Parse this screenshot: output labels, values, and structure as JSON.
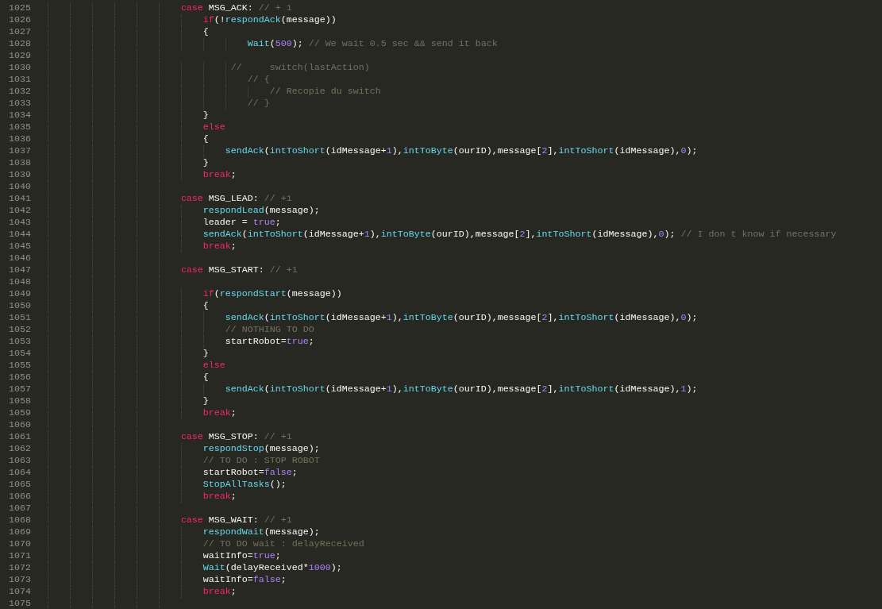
{
  "editor": {
    "lines": [
      {
        "number": "1025",
        "tokens": [
          {
            "kind": "keyword",
            "text": "\t\t\t\t\t\tcase"
          },
          {
            "kind": "plain",
            "text": " MSG_ACK: "
          },
          {
            "kind": "comment",
            "text": "// + 1"
          }
        ]
      },
      {
        "number": "1026",
        "tokens": [
          {
            "kind": "keyword",
            "text": "\t\t\t\t\t\t\tif"
          },
          {
            "kind": "plain",
            "text": "(!"
          },
          {
            "kind": "function",
            "text": "respondAck"
          },
          {
            "kind": "plain",
            "text": "(message))"
          }
        ]
      },
      {
        "number": "1027",
        "tokens": [
          {
            "kind": "plain",
            "text": "\t\t\t\t\t\t\t{"
          }
        ]
      },
      {
        "number": "1028",
        "tokens": [
          {
            "kind": "function",
            "text": "\t\t\t\t\t\t\t\t\tWait"
          },
          {
            "kind": "plain",
            "text": "("
          },
          {
            "kind": "number",
            "text": "500"
          },
          {
            "kind": "plain",
            "text": "); "
          },
          {
            "kind": "comment",
            "text": "// We wait 0.5 sec && send it back"
          }
        ]
      },
      {
        "number": "1029"
      },
      {
        "number": "1030",
        "tokens": [
          {
            "kind": "comment",
            "text": "\t\t\t\t\t\t\t\t //     switch(lastAction)"
          }
        ]
      },
      {
        "number": "1031",
        "tokens": [
          {
            "kind": "comment",
            "text": "\t\t\t\t\t\t\t\t\t// {"
          }
        ]
      },
      {
        "number": "1032",
        "tokens": [
          {
            "kind": "comment",
            "text": "\t\t\t\t\t\t\t\t\t\t// Recopie du switch"
          }
        ]
      },
      {
        "number": "1033",
        "tokens": [
          {
            "kind": "comment",
            "text": "\t\t\t\t\t\t\t\t\t// }"
          }
        ]
      },
      {
        "number": "1034",
        "tokens": [
          {
            "kind": "plain",
            "text": "\t\t\t\t\t\t\t}"
          }
        ]
      },
      {
        "number": "1035",
        "tokens": [
          {
            "kind": "keyword",
            "text": "\t\t\t\t\t\t\telse"
          }
        ]
      },
      {
        "number": "1036",
        "tokens": [
          {
            "kind": "plain",
            "text": "\t\t\t\t\t\t\t{"
          }
        ]
      },
      {
        "number": "1037",
        "tokens": [
          {
            "kind": "function",
            "text": "\t\t\t\t\t\t\t\tsendAck"
          },
          {
            "kind": "plain",
            "text": "("
          },
          {
            "kind": "function",
            "text": "intToShort"
          },
          {
            "kind": "plain",
            "text": "(idMessage+"
          },
          {
            "kind": "number",
            "text": "1"
          },
          {
            "kind": "plain",
            "text": "),"
          },
          {
            "kind": "function",
            "text": "intToByte"
          },
          {
            "kind": "plain",
            "text": "(ourID),message["
          },
          {
            "kind": "number",
            "text": "2"
          },
          {
            "kind": "plain",
            "text": "],"
          },
          {
            "kind": "function",
            "text": "intToShort"
          },
          {
            "kind": "plain",
            "text": "(idMessage),"
          },
          {
            "kind": "number",
            "text": "0"
          },
          {
            "kind": "plain",
            "text": ");"
          }
        ]
      },
      {
        "number": "1038",
        "tokens": [
          {
            "kind": "plain",
            "text": "\t\t\t\t\t\t\t}"
          }
        ]
      },
      {
        "number": "1039",
        "tokens": [
          {
            "kind": "keyword",
            "text": "\t\t\t\t\t\t\tbreak"
          },
          {
            "kind": "plain",
            "text": ";"
          }
        ]
      },
      {
        "number": "1040"
      },
      {
        "number": "1041",
        "tokens": [
          {
            "kind": "keyword",
            "text": "\t\t\t\t\t\tcase"
          },
          {
            "kind": "plain",
            "text": " MSG_LEAD: "
          },
          {
            "kind": "comment",
            "text": "// +1"
          }
        ]
      },
      {
        "number": "1042",
        "tokens": [
          {
            "kind": "function",
            "text": "\t\t\t\t\t\t\trespondLead"
          },
          {
            "kind": "plain",
            "text": "(message);"
          }
        ]
      },
      {
        "number": "1043",
        "tokens": [
          {
            "kind": "plain",
            "text": "\t\t\t\t\t\t\tleader = "
          },
          {
            "kind": "number",
            "text": "true"
          },
          {
            "kind": "plain",
            "text": ";"
          }
        ]
      },
      {
        "number": "1044",
        "tokens": [
          {
            "kind": "function",
            "text": "\t\t\t\t\t\t\tsendAck"
          },
          {
            "kind": "plain",
            "text": "("
          },
          {
            "kind": "function",
            "text": "intToShort"
          },
          {
            "kind": "plain",
            "text": "(idMessage+"
          },
          {
            "kind": "number",
            "text": "1"
          },
          {
            "kind": "plain",
            "text": "),"
          },
          {
            "kind": "function",
            "text": "intToByte"
          },
          {
            "kind": "plain",
            "text": "(ourID),message["
          },
          {
            "kind": "number",
            "text": "2"
          },
          {
            "kind": "plain",
            "text": "],"
          },
          {
            "kind": "function",
            "text": "intToShort"
          },
          {
            "kind": "plain",
            "text": "(idMessage),"
          },
          {
            "kind": "number",
            "text": "0"
          },
          {
            "kind": "plain",
            "text": "); "
          },
          {
            "kind": "comment",
            "text": "// I don t know if necessary"
          }
        ]
      },
      {
        "number": "1045",
        "tokens": [
          {
            "kind": "keyword",
            "text": "\t\t\t\t\t\t\tbreak"
          },
          {
            "kind": "plain",
            "text": ";"
          }
        ]
      },
      {
        "number": "1046"
      },
      {
        "number": "1047",
        "tokens": [
          {
            "kind": "keyword",
            "text": "\t\t\t\t\t\tcase"
          },
          {
            "kind": "plain",
            "text": " MSG_START: "
          },
          {
            "kind": "comment",
            "text": "// +1"
          }
        ]
      },
      {
        "number": "1048"
      },
      {
        "number": "1049",
        "tokens": [
          {
            "kind": "keyword",
            "text": "\t\t\t\t\t\t\tif"
          },
          {
            "kind": "plain",
            "text": "("
          },
          {
            "kind": "function",
            "text": "respondStart"
          },
          {
            "kind": "plain",
            "text": "(message))"
          }
        ]
      },
      {
        "number": "1050",
        "tokens": [
          {
            "kind": "plain",
            "text": "\t\t\t\t\t\t\t{"
          }
        ]
      },
      {
        "number": "1051",
        "tokens": [
          {
            "kind": "function",
            "text": "\t\t\t\t\t\t\t\tsendAck"
          },
          {
            "kind": "plain",
            "text": "("
          },
          {
            "kind": "function",
            "text": "intToShort"
          },
          {
            "kind": "plain",
            "text": "(idMessage+"
          },
          {
            "kind": "number",
            "text": "1"
          },
          {
            "kind": "plain",
            "text": "),"
          },
          {
            "kind": "function",
            "text": "intToByte"
          },
          {
            "kind": "plain",
            "text": "(ourID),message["
          },
          {
            "kind": "number",
            "text": "2"
          },
          {
            "kind": "plain",
            "text": "],"
          },
          {
            "kind": "function",
            "text": "intToShort"
          },
          {
            "kind": "plain",
            "text": "(idMessage),"
          },
          {
            "kind": "number",
            "text": "0"
          },
          {
            "kind": "plain",
            "text": ");"
          }
        ]
      },
      {
        "number": "1052",
        "tokens": [
          {
            "kind": "comment",
            "text": "\t\t\t\t\t\t\t\t// NOTHING TO DO"
          }
        ]
      },
      {
        "number": "1053",
        "tokens": [
          {
            "kind": "plain",
            "text": "\t\t\t\t\t\t\t\tstartRobot="
          },
          {
            "kind": "number",
            "text": "true"
          },
          {
            "kind": "plain",
            "text": ";"
          }
        ]
      },
      {
        "number": "1054",
        "tokens": [
          {
            "kind": "plain",
            "text": "\t\t\t\t\t\t\t}"
          }
        ]
      },
      {
        "number": "1055",
        "tokens": [
          {
            "kind": "keyword",
            "text": "\t\t\t\t\t\t\telse"
          }
        ]
      },
      {
        "number": "1056",
        "tokens": [
          {
            "kind": "plain",
            "text": "\t\t\t\t\t\t\t{"
          }
        ]
      },
      {
        "number": "1057",
        "tokens": [
          {
            "kind": "function",
            "text": "\t\t\t\t\t\t\t\tsendAck"
          },
          {
            "kind": "plain",
            "text": "("
          },
          {
            "kind": "function",
            "text": "intToShort"
          },
          {
            "kind": "plain",
            "text": "(idMessage+"
          },
          {
            "kind": "number",
            "text": "1"
          },
          {
            "kind": "plain",
            "text": "),"
          },
          {
            "kind": "function",
            "text": "intToByte"
          },
          {
            "kind": "plain",
            "text": "(ourID),message["
          },
          {
            "kind": "number",
            "text": "2"
          },
          {
            "kind": "plain",
            "text": "],"
          },
          {
            "kind": "function",
            "text": "intToShort"
          },
          {
            "kind": "plain",
            "text": "(idMessage),"
          },
          {
            "kind": "number",
            "text": "1"
          },
          {
            "kind": "plain",
            "text": ");"
          }
        ]
      },
      {
        "number": "1058",
        "tokens": [
          {
            "kind": "plain",
            "text": "\t\t\t\t\t\t\t}"
          }
        ]
      },
      {
        "number": "1059",
        "tokens": [
          {
            "kind": "keyword",
            "text": "\t\t\t\t\t\t\tbreak"
          },
          {
            "kind": "plain",
            "text": ";"
          }
        ]
      },
      {
        "number": "1060"
      },
      {
        "number": "1061",
        "tokens": [
          {
            "kind": "keyword",
            "text": "\t\t\t\t\t\tcase"
          },
          {
            "kind": "plain",
            "text": " MSG_STOP: "
          },
          {
            "kind": "comment",
            "text": "// +1"
          }
        ]
      },
      {
        "number": "1062",
        "tokens": [
          {
            "kind": "function",
            "text": "\t\t\t\t\t\t\trespondStop"
          },
          {
            "kind": "plain",
            "text": "(message);"
          }
        ]
      },
      {
        "number": "1063",
        "tokens": [
          {
            "kind": "comment",
            "text": "\t\t\t\t\t\t\t// TO DO : STOP ROBOT"
          }
        ]
      },
      {
        "number": "1064",
        "tokens": [
          {
            "kind": "plain",
            "text": "\t\t\t\t\t\t\tstartRobot="
          },
          {
            "kind": "number",
            "text": "false"
          },
          {
            "kind": "plain",
            "text": ";"
          }
        ]
      },
      {
        "number": "1065",
        "tokens": [
          {
            "kind": "function",
            "text": "\t\t\t\t\t\t\tStopAllTasks"
          },
          {
            "kind": "plain",
            "text": "();"
          }
        ]
      },
      {
        "number": "1066",
        "tokens": [
          {
            "kind": "keyword",
            "text": "\t\t\t\t\t\t\tbreak"
          },
          {
            "kind": "plain",
            "text": ";"
          }
        ]
      },
      {
        "number": "1067"
      },
      {
        "number": "1068",
        "tokens": [
          {
            "kind": "keyword",
            "text": "\t\t\t\t\t\tcase"
          },
          {
            "kind": "plain",
            "text": " MSG_WAIT: "
          },
          {
            "kind": "comment",
            "text": "// +1"
          }
        ]
      },
      {
        "number": "1069",
        "tokens": [
          {
            "kind": "function",
            "text": "\t\t\t\t\t\t\trespondWait"
          },
          {
            "kind": "plain",
            "text": "(message);"
          }
        ]
      },
      {
        "number": "1070",
        "tokens": [
          {
            "kind": "comment",
            "text": "\t\t\t\t\t\t\t// TO DO wait : delayReceived"
          }
        ]
      },
      {
        "number": "1071",
        "tokens": [
          {
            "kind": "plain",
            "text": "\t\t\t\t\t\t\twaitInfo="
          },
          {
            "kind": "number",
            "text": "true"
          },
          {
            "kind": "plain",
            "text": ";"
          }
        ]
      },
      {
        "number": "1072",
        "tokens": [
          {
            "kind": "function",
            "text": "\t\t\t\t\t\t\tWait"
          },
          {
            "kind": "plain",
            "text": "(delayReceived*"
          },
          {
            "kind": "number",
            "text": "1000"
          },
          {
            "kind": "plain",
            "text": ");"
          }
        ]
      },
      {
        "number": "1073",
        "tokens": [
          {
            "kind": "plain",
            "text": "\t\t\t\t\t\t\twaitInfo="
          },
          {
            "kind": "number",
            "text": "false"
          },
          {
            "kind": "plain",
            "text": ";"
          }
        ]
      },
      {
        "number": "1074",
        "tokens": [
          {
            "kind": "keyword",
            "text": "\t\t\t\t\t\t\tbreak"
          },
          {
            "kind": "plain",
            "text": ";"
          }
        ]
      },
      {
        "number": "1075"
      }
    ]
  }
}
